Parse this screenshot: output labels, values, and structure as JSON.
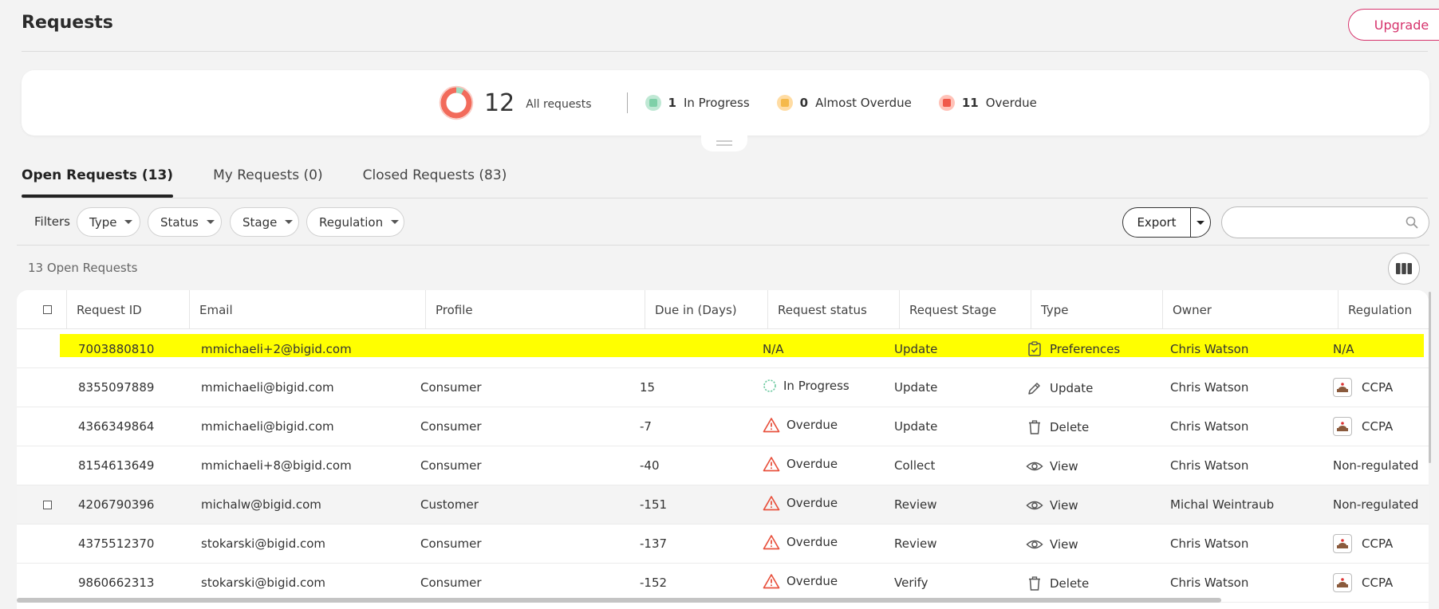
{
  "page": {
    "title": "Requests",
    "upgrade_label": "Upgrade"
  },
  "summary": {
    "total": "12",
    "total_label": "All requests",
    "stats": [
      {
        "count": "1",
        "label": "In Progress",
        "color": "#bfe8d4",
        "inner": "#7fd0a8"
      },
      {
        "count": "0",
        "label": "Almost Overdue",
        "color": "#ffdca3",
        "inner": "#f5b94a"
      },
      {
        "count": "11",
        "label": "Overdue",
        "color": "#ffc2b8",
        "inner": "#f0594a"
      }
    ]
  },
  "tabs": [
    {
      "label": "Open Requests (13)",
      "active": true
    },
    {
      "label": "My Requests (0)",
      "active": false
    },
    {
      "label": "Closed Requests (83)",
      "active": false
    }
  ],
  "filters": {
    "label": "Filters",
    "items": [
      "Type",
      "Status",
      "Stage",
      "Regulation"
    ],
    "export_label": "Export",
    "search_placeholder": ""
  },
  "table": {
    "count_label": "13 Open Requests",
    "columns": [
      "Request ID",
      "Email",
      "Profile",
      "Due in (Days)",
      "Request status",
      "Request Stage",
      "Type",
      "Owner",
      "Regulation"
    ],
    "rows": [
      {
        "id": "7003880810",
        "email": "mmichaeli+2@bigid.com",
        "profile": "",
        "due": "",
        "status": "N/A",
        "status_icon": "",
        "stage": "Update",
        "type": "Preferences",
        "type_icon": "preferences-icon",
        "owner": "Chris Watson",
        "regulation": "N/A",
        "reg_icon": false
      },
      {
        "id": "8355097889",
        "email": "mmichaeli@bigid.com",
        "profile": "Consumer",
        "due": "15",
        "status": "In Progress",
        "status_icon": "in-progress-icon",
        "stage": "Update",
        "type": "Update",
        "type_icon": "pencil-icon",
        "owner": "Chris Watson",
        "regulation": "CCPA",
        "reg_icon": true
      },
      {
        "id": "4366349864",
        "email": "mmichaeli@bigid.com",
        "profile": "Consumer",
        "due": "-7",
        "status": "Overdue",
        "status_icon": "warning-icon",
        "stage": "Update",
        "type": "Delete",
        "type_icon": "trash-icon",
        "owner": "Chris Watson",
        "regulation": "CCPA",
        "reg_icon": true
      },
      {
        "id": "8154613649",
        "email": "mmichaeli+8@bigid.com",
        "profile": "Consumer",
        "due": "-40",
        "status": "Overdue",
        "status_icon": "warning-icon",
        "stage": "Collect",
        "type": "View",
        "type_icon": "eye-icon",
        "owner": "Chris Watson",
        "regulation": "Non-regulated",
        "reg_icon": false
      },
      {
        "id": "4206790396",
        "email": "michalw@bigid.com",
        "profile": "Customer",
        "due": "-151",
        "status": "Overdue",
        "status_icon": "warning-icon",
        "stage": "Review",
        "type": "View",
        "type_icon": "eye-icon",
        "owner": "Michal Weintraub",
        "regulation": "Non-regulated",
        "reg_icon": false
      },
      {
        "id": "4375512370",
        "email": "stokarski@bigid.com",
        "profile": "Consumer",
        "due": "-137",
        "status": "Overdue",
        "status_icon": "warning-icon",
        "stage": "Review",
        "type": "View",
        "type_icon": "eye-icon",
        "owner": "Chris Watson",
        "regulation": "CCPA",
        "reg_icon": true
      },
      {
        "id": "9860662313",
        "email": "stokarski@bigid.com",
        "profile": "Consumer",
        "due": "-152",
        "status": "Overdue",
        "status_icon": "warning-icon",
        "stage": "Verify",
        "type": "Delete",
        "type_icon": "trash-icon",
        "owner": "Chris Watson",
        "regulation": "CCPA",
        "reg_icon": true
      }
    ]
  },
  "colors": {
    "accent": "#d6336c",
    "highlight": "#ffff00",
    "overdue": "#e8513d",
    "in_progress": "#6cc9a0"
  }
}
